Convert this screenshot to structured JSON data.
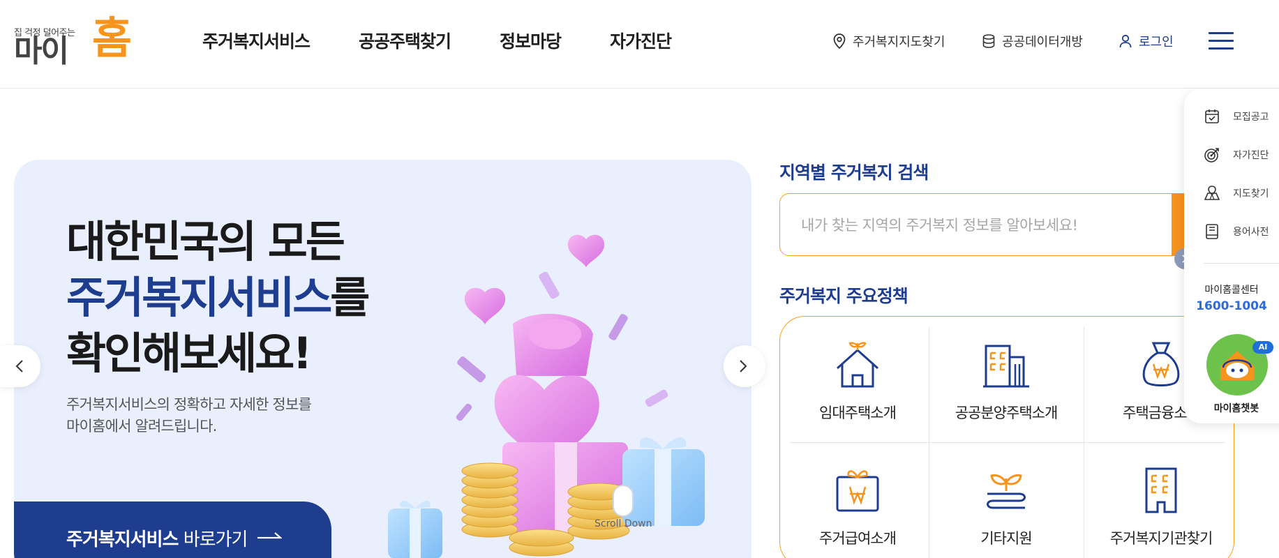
{
  "logo": {
    "tagline": "집 걱정 덜어주는",
    "main": "마이",
    "home": "홈"
  },
  "gnb": [
    "주거복지서비스",
    "공공주택찾기",
    "정보마당",
    "자가진단"
  ],
  "util": {
    "map": "주거복지지도찾기",
    "data": "공공데이터개방",
    "login": "로그인"
  },
  "hero": {
    "title_line1": "대한민국의 모든",
    "title_hl": "주거복지서비스",
    "title_line2_suffix": "를",
    "title_line3": "확인해보세요!",
    "subtitle": "주거복지서비스의 정확하고 자세한 정보를\n마이홈에서 알려드립니다.",
    "cta_strong": "주거복지서비스",
    "cta_rest": " 바로가기",
    "scroll_label": "Scroll Down"
  },
  "search": {
    "title": "지역별 주거복지 검색",
    "placeholder": "내가 찾는 지역의 주거복지 정보를 알아보세요!"
  },
  "policy": {
    "title": "주거복지 주요정책",
    "items": [
      {
        "label": "임대주택소개",
        "icon": "house-sprout-icon"
      },
      {
        "label": "공공분양주택소개",
        "icon": "buildings-icon"
      },
      {
        "label": "주택금융소개",
        "icon": "money-bag-icon"
      },
      {
        "label": "주거급여소개",
        "icon": "gift-won-icon"
      },
      {
        "label": "기타지원",
        "icon": "sprout-hand-icon"
      },
      {
        "label": "주거복지기관찾기",
        "icon": "office-building-icon"
      }
    ]
  },
  "quick": {
    "items": [
      {
        "label": "모집공고",
        "icon": "calendar-check-icon"
      },
      {
        "label": "자가진단",
        "icon": "target-icon"
      },
      {
        "label": "지도찾기",
        "icon": "map-icon"
      },
      {
        "label": "용어사전",
        "icon": "book-icon"
      }
    ],
    "call_label": "마이홈콜센터",
    "call_number": "1600-1004",
    "ai_badge": "AI",
    "chatbot_label": "마이홈챗봇"
  },
  "colors": {
    "brand_blue": "#1e3d8f",
    "brand_orange": "#f7941d",
    "hero_bg": "#e9effc"
  }
}
